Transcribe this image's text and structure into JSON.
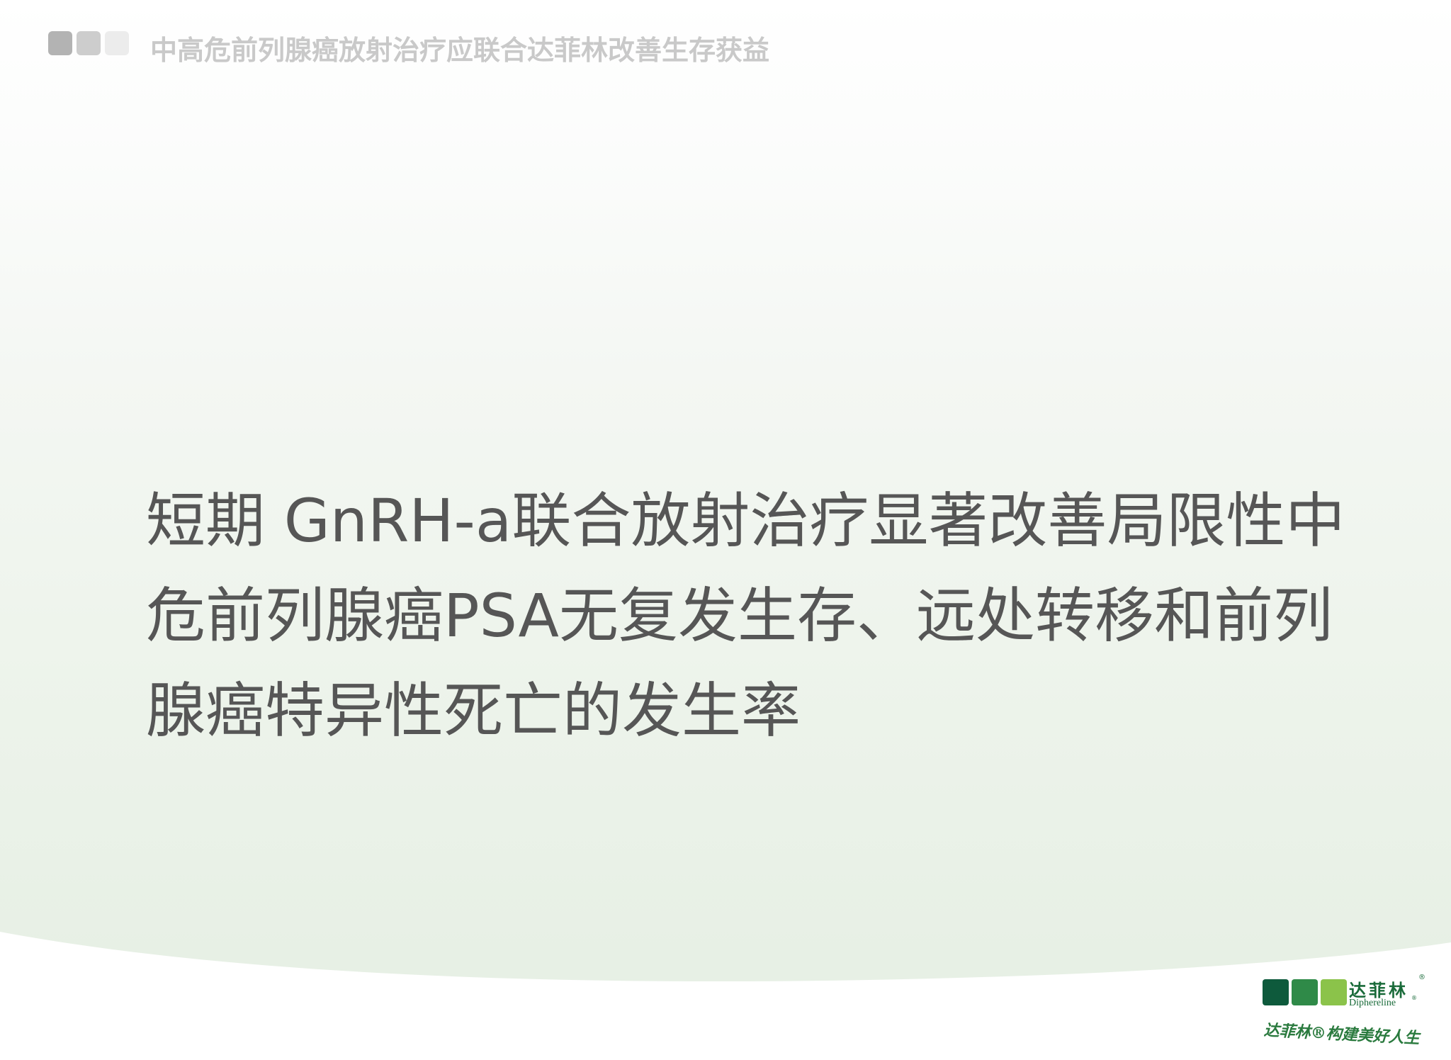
{
  "header": {
    "title": "中高危前列腺癌放射治疗应联合达菲林改善生存获益"
  },
  "main": {
    "lines": [
      "短期 GnRH-a联合放射治疗显著改善局限性中",
      "危前列腺癌PSA无复发生存、远处转移和前列",
      "腺癌特异性死亡的发生率"
    ]
  },
  "logo": {
    "cn_name": "达菲林",
    "en_name": "Diphereline",
    "registered": "®",
    "slogan": "达菲林®构建美好人生"
  },
  "colors": {
    "title_text": "#565656",
    "header_text": "#c9c9c9",
    "brand_dark_green": "#0e5a3c",
    "brand_mid_green": "#2f8a48",
    "brand_light_green": "#8bc34a"
  }
}
